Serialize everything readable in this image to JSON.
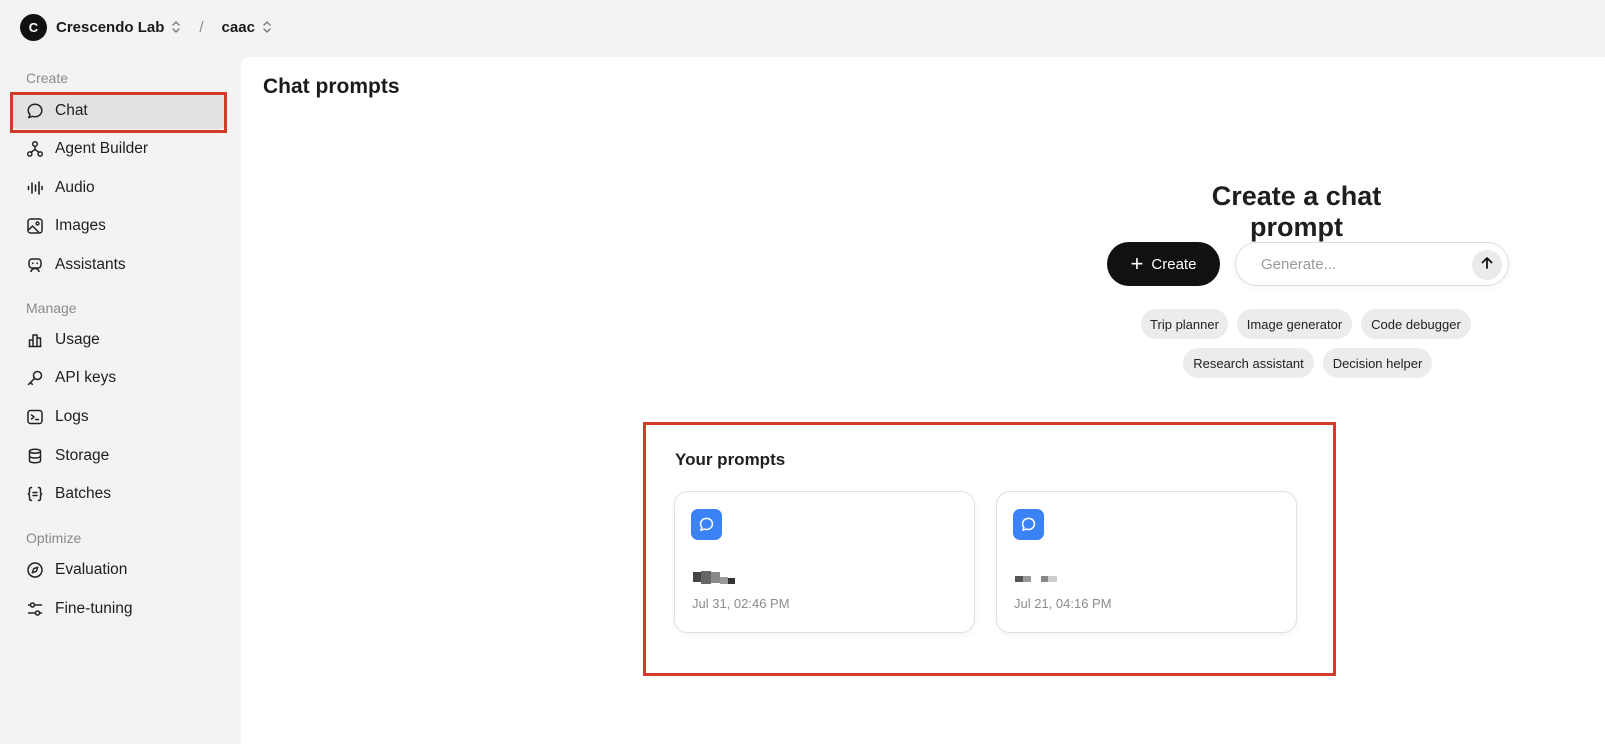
{
  "topbar": {
    "org_initial": "C",
    "org_name": "Crescendo Lab",
    "separator": "/",
    "project_name": "caac"
  },
  "sidebar": {
    "sections": [
      {
        "title": "Create",
        "items": [
          {
            "label": "Chat",
            "icon": "chat-bubble-icon",
            "active": true
          },
          {
            "label": "Agent Builder",
            "icon": "agent-builder-icon"
          },
          {
            "label": "Audio",
            "icon": "audio-wave-icon"
          },
          {
            "label": "Images",
            "icon": "image-icon"
          },
          {
            "label": "Assistants",
            "icon": "robot-icon"
          }
        ]
      },
      {
        "title": "Manage",
        "items": [
          {
            "label": "Usage",
            "icon": "bar-chart-icon"
          },
          {
            "label": "API keys",
            "icon": "key-icon"
          },
          {
            "label": "Logs",
            "icon": "terminal-icon"
          },
          {
            "label": "Storage",
            "icon": "database-icon"
          },
          {
            "label": "Batches",
            "icon": "braces-icon"
          }
        ]
      },
      {
        "title": "Optimize",
        "items": [
          {
            "label": "Evaluation",
            "icon": "compass-icon"
          },
          {
            "label": "Fine-tuning",
            "icon": "sliders-icon"
          }
        ]
      }
    ]
  },
  "main": {
    "page_title": "Chat prompts",
    "create_heading": "Create a chat prompt",
    "create_button": "Create",
    "generate_placeholder": "Generate...",
    "suggestions": [
      "Trip planner",
      "Image generator",
      "Code debugger",
      "Research assistant",
      "Decision helper"
    ],
    "prompts_title": "Your prompts",
    "prompts": [
      {
        "icon": "chat-bubble-icon",
        "date": "Jul 31, 02:46 PM"
      },
      {
        "icon": "chat-bubble-icon",
        "date": "Jul 21, 04:16 PM"
      }
    ]
  },
  "colors": {
    "accent_blue": "#3b82f6",
    "highlight_red": "#d23a2a",
    "button_black": "#111111"
  }
}
